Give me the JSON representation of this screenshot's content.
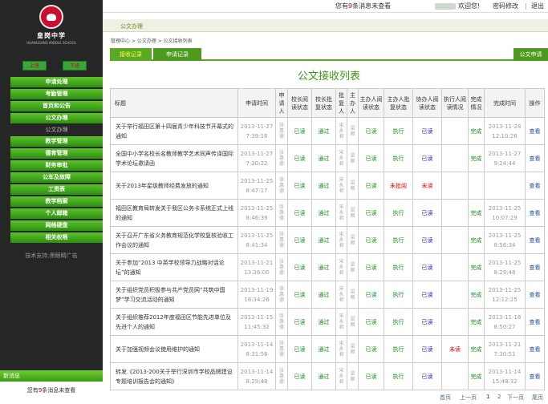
{
  "header": {
    "notice_pre": "您有",
    "notice_count": "9",
    "notice_post": "条消息未查看",
    "welcome": "欢迎您!",
    "change_pwd": "密码修改",
    "logout": "退出"
  },
  "sidebar": {
    "school_name": "皇岗中学",
    "school_en": "HUANGGANG MIDDLE SCHOOL",
    "btn_left": "上班",
    "btn_right": "下班",
    "menu": [
      "申请处理",
      "考勤管理",
      "首页和公告",
      "公文办理",
      "公文办理",
      "教学管理",
      "德育管理",
      "财务审批",
      "公车及故障",
      "工资表",
      "教学档案",
      "个人邮箱",
      "网络硬盘",
      "相关权限"
    ],
    "support": "技术支持:黑眼睛广告",
    "newmsg_title": "新消息",
    "newmsg_pre": "您有",
    "newmsg_count": "9",
    "newmsg_post": "条消息未查看"
  },
  "tab": {
    "label": "公文办理"
  },
  "breadcrumb": "管理中心 > 公文办理 > 公文接收列表",
  "subtabs": {
    "receive": "接收记录",
    "apply": "申请记录",
    "new": "公文申请"
  },
  "page_title": "公文接收列表",
  "table": {
    "headers": [
      "标题",
      "申请时间",
      "申请人",
      "校长阅读状态",
      "校长批复状态",
      "批复人",
      "主办人",
      "主办人阅读状态",
      "主办人批复状态",
      "协办人阅读状态",
      "执行人阅读情况",
      "完成情况",
      "完成时间",
      "操作"
    ],
    "rows": [
      [
        "关于举行福田区第十四届青少年科技节开幕式的通知",
        "2013-11-27 7:39:16",
        "张惠德",
        "已读",
        "通过",
        "宋永君",
        "梁顺",
        "已读",
        "执行",
        "已读",
        "",
        "完成",
        "2013-11-28 12:10:26",
        "查看"
      ],
      [
        "全国中小学名校长名教师教学艺术同声传译国际学术论坛邀请函",
        "2013-11-27 7:30:22",
        "张惠德",
        "已读",
        "通过",
        "宋永君",
        "梁顺",
        "已读",
        "执行",
        "已读",
        "",
        "完成",
        "2013-11-27 9:24:44",
        "查看"
      ],
      [
        "关于2013年星级教师经费发放的通知",
        "2013-11-25 8:47:17",
        "张惠德",
        "已读",
        "通过",
        "宋永君",
        "梁顺",
        "已读",
        "未批阅",
        "未读",
        "",
        "",
        "",
        "查看"
      ],
      [
        "福田区教育局转发关于我区公务卡系统正式上线的通知",
        "2013-11-25 8:46:39",
        "张惠德",
        "已读",
        "通过",
        "宋永君",
        "梁顺",
        "已读",
        "执行",
        "已读",
        "",
        "完成",
        "2013-11-25 10:07:29",
        "查看"
      ],
      [
        "关于召开广东省义务教育规范化学校复核验收工作会议的通知",
        "2013-11-25 8:41:34",
        "张惠德",
        "已读",
        "通过",
        "宋永君",
        "梁顺",
        "已读",
        "执行",
        "已读",
        "",
        "完成",
        "2013-11-25 8:56:34",
        "查看"
      ],
      [
        "关于参加“2013 中英学校领导力战略对话论坛”的通知",
        "2013-11-21 13:36:00",
        "张惠德",
        "已读",
        "通过",
        "宋永君",
        "梁顺",
        "已读",
        "执行",
        "已读",
        "",
        "完成",
        "2013-11-25 8:29:48",
        "查看"
      ],
      [
        "关于组织党员积极参与共产党员网“共筑中国梦”学习交流活动的通知",
        "2013-11-19 18:34:26",
        "张惠德",
        "已读",
        "通过",
        "宋永君",
        "梁顺",
        "已读",
        "执行",
        "已读",
        "",
        "完成",
        "2013-11-25 12:12:25",
        "查看"
      ],
      [
        "关于组织推荐2012年度福田区节能先进单位及先进个人的通知",
        "2013-11-15 11:45:32",
        "张惠德",
        "已读",
        "通过",
        "宋永君",
        "梁顺",
        "已读",
        "执行",
        "已读",
        "",
        "完成",
        "2013-11-18 8:50:27",
        "查看"
      ],
      [
        "关于加强视频会议使用维护的通知",
        "2013-11-14 8:31:56",
        "张惠德",
        "已读",
        "通过",
        "宋永君",
        "梁顺",
        "已读",
        "执行",
        "已读",
        "未读",
        "完成",
        "2013-11-21 7:30:51",
        "查看"
      ],
      [
        "转发《2013-200关于举行深圳市学校品牌建设专题培训报告会的通知》",
        "2013-11-14 8:29:48",
        "张惠德",
        "已读",
        "通过",
        "宋永君",
        "梁顺",
        "已读",
        "执行",
        "已读",
        "",
        "完成",
        "2013-11-14 15:48:32",
        "查看"
      ]
    ]
  },
  "pager": {
    "first": "首页",
    "prev": "上一页",
    "p1": "1",
    "p2": "2",
    "next": "下一页",
    "last": "尾页"
  }
}
